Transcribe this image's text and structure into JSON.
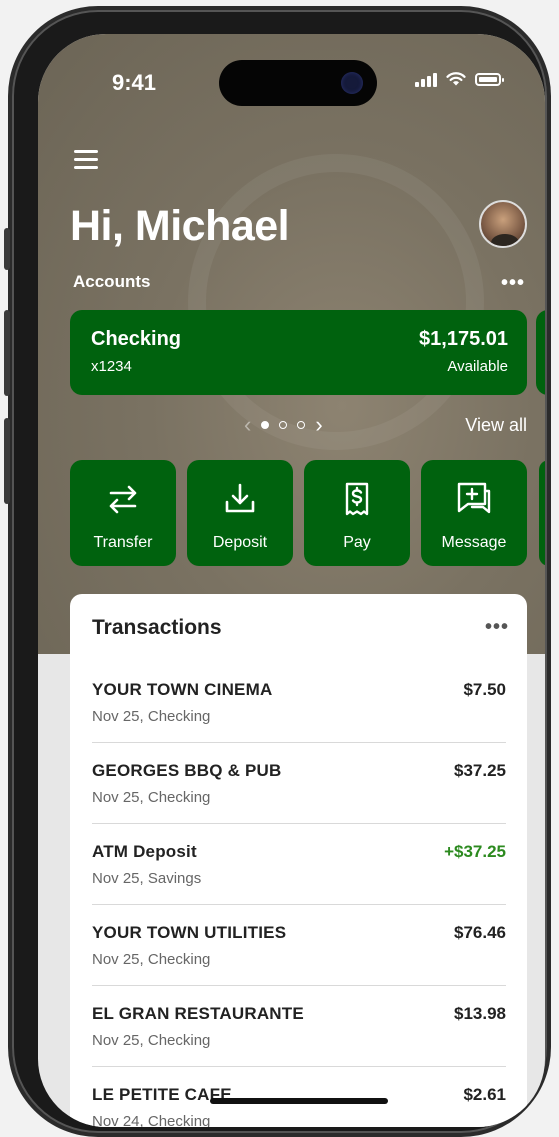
{
  "status": {
    "time": "9:41"
  },
  "header": {
    "greeting": "Hi, Michael"
  },
  "accounts": {
    "label": "Accounts",
    "more": "•••",
    "card": {
      "name": "Checking",
      "number": "x1234",
      "balance": "$1,175.01",
      "balance_label": "Available"
    },
    "pager": {
      "prev": "‹",
      "next": "›",
      "page_count": 3,
      "active_page": 1
    },
    "view_all": "View all"
  },
  "actions": [
    {
      "label": "Transfer",
      "icon": "transfer-icon"
    },
    {
      "label": "Deposit",
      "icon": "deposit-icon"
    },
    {
      "label": "Pay",
      "icon": "pay-receipt-icon"
    },
    {
      "label": "Message",
      "icon": "message-icon"
    }
  ],
  "transactions": {
    "title": "Transactions",
    "more": "•••",
    "items": [
      {
        "merchant": "YOUR TOWN CINEMA",
        "detail": "Nov 25, Checking",
        "amount": "$7.50"
      },
      {
        "merchant": "GEORGES BBQ & PUB",
        "detail": "Nov 25, Checking",
        "amount": "$37.25"
      },
      {
        "merchant": "ATM Deposit",
        "detail": "Nov 25, Savings",
        "amount": "+$37.25"
      },
      {
        "merchant": "YOUR TOWN UTILITIES",
        "detail": "Nov 25, Checking",
        "amount": "$76.46"
      },
      {
        "merchant": "EL GRAN RESTAURANTE",
        "detail": "Nov 25, Checking",
        "amount": "$13.98"
      },
      {
        "merchant": "LE PETITE CAFE",
        "detail": "Nov 24, Checking",
        "amount": "$2.61"
      }
    ]
  },
  "colors": {
    "brand_green": "#00620e",
    "credit_green": "#2c8a1f"
  }
}
